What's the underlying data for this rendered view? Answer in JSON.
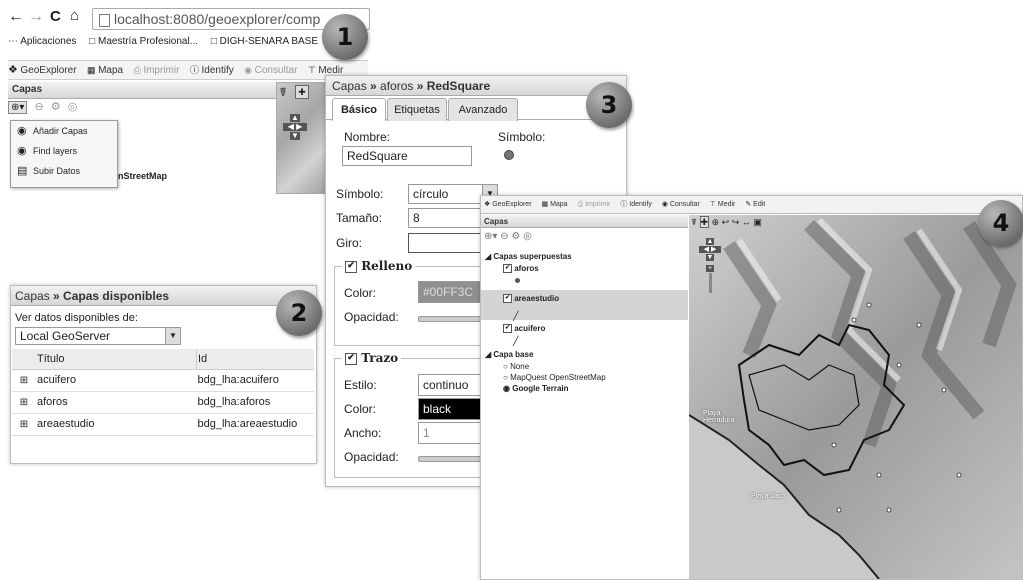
{
  "browser": {
    "url": "localhost:8080/geoexplorer/comp",
    "bookmarks": [
      "Aplicaciones",
      "Maestría Profesional...",
      "DIGH-SENARA BASE"
    ]
  },
  "toolbar": {
    "app": "GeoExplorer",
    "mapa": "Mapa",
    "imprimir": "Imprimir",
    "identify": "Identify",
    "consultar": "Consultar",
    "medir": "Medir",
    "edit": "Edit"
  },
  "panel1": {
    "title": "Capas",
    "menu": [
      "Añadir Capas",
      "Find layers",
      "Subir Datos"
    ],
    "osm_label": "nStreetMap"
  },
  "panel2": {
    "breadcrumb_root": "Capas",
    "breadcrumb_current": "Capas disponibles",
    "source_label": "Ver datos disponibles de:",
    "source_value": "Local GeoServer",
    "columns": [
      "Título",
      "Id"
    ],
    "rows": [
      {
        "titulo": "acuifero",
        "id": "bdg_lha:acuifero"
      },
      {
        "titulo": "aforos",
        "id": "bdg_lha:aforos"
      },
      {
        "titulo": "areaestudio",
        "id": "bdg_lha:areaestudio"
      }
    ]
  },
  "panel3": {
    "breadcrumb_root": "Capas",
    "breadcrumb_mid": "aforos",
    "breadcrumb_current": "RedSquare",
    "tabs": [
      "Básico",
      "Etiquetas",
      "Avanzado"
    ],
    "nombre_label": "Nombre:",
    "nombre_value": "RedSquare",
    "simbolo_label": "Símbolo:",
    "simbolo_field_label": "Símbolo:",
    "simbolo_value": "círculo",
    "tamano_label": "Tamaño:",
    "tamano_value": "8",
    "giro_label": "Giro:",
    "relleno_title": "Relleno",
    "relleno_color_label": "Color:",
    "relleno_color_value": "#00FF3C",
    "relleno_opacidad_label": "Opacidad:",
    "trazo_title": "Trazo",
    "estilo_label": "Estilo:",
    "estilo_value": "continuo",
    "trazo_color_label": "Color:",
    "trazo_color_value": "black",
    "ancho_label": "Ancho:",
    "ancho_value": "1",
    "trazo_opacidad_label": "Opacidad:"
  },
  "panel4": {
    "title": "Capas",
    "group_overlays": "Capas superpuestas",
    "layers": [
      "aforos",
      "areaestudio",
      "acuifero"
    ],
    "group_base": "Capa base",
    "base_layers": [
      "None",
      "MapQuest OpenStreetMap",
      "Google Terrain"
    ],
    "map_labels": [
      "Playa Herradura",
      "Playa Jacó"
    ]
  },
  "badges": [
    "1",
    "2",
    "3",
    "4"
  ]
}
